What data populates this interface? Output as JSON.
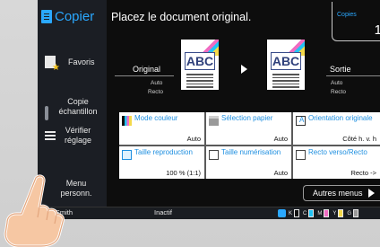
{
  "app": {
    "title": "Copier"
  },
  "sidebar": {
    "favorites": "Favoris",
    "sample_copy": "Copie\néchantillon",
    "check_settings": "Vérifier\nréglage",
    "menu": "Menu\npersonn."
  },
  "header": {
    "message": "Placez le document original."
  },
  "copies": {
    "label": "Copies",
    "value": "1"
  },
  "original": {
    "label": "Original",
    "line1": "Auto",
    "line2": "Recto",
    "doc_text": "ABC"
  },
  "output": {
    "label": "Sortie",
    "line1": "Auto",
    "line2": "Recto",
    "doc_text": "ABC"
  },
  "tiles": [
    {
      "title": "Mode couleur",
      "value": "Auto",
      "icon": "color-mode-icon"
    },
    {
      "title": "Sélection papier",
      "value": "Auto",
      "icon": "paper-icon"
    },
    {
      "title": "Orientation originale",
      "value": "Côté h. v. h",
      "icon": "orientation-icon"
    },
    {
      "title": "Taille reproduction",
      "value": "100 % (1:1)",
      "icon": "reproduction-icon"
    },
    {
      "title": "Taille numérisation",
      "value": "Auto",
      "icon": "scan-size-icon"
    },
    {
      "title": "Recto verso/Recto",
      "value": "Recto ->",
      "icon": "duplex-icon"
    }
  ],
  "more_button": "Autres menus",
  "status_bar": {
    "user": "J.Smith",
    "status": "Inactif",
    "toner": [
      {
        "label": "K",
        "color": "#111111"
      },
      {
        "label": "C",
        "color": "#22c3f5"
      },
      {
        "label": "M",
        "color": "#f06cc2"
      },
      {
        "label": "Y",
        "color": "#f4d94a"
      },
      {
        "label": "G",
        "color": "#9a9a9a"
      }
    ]
  },
  "colors": {
    "accent": "#2aa8ff",
    "tile_title": "#1e8fe0"
  }
}
